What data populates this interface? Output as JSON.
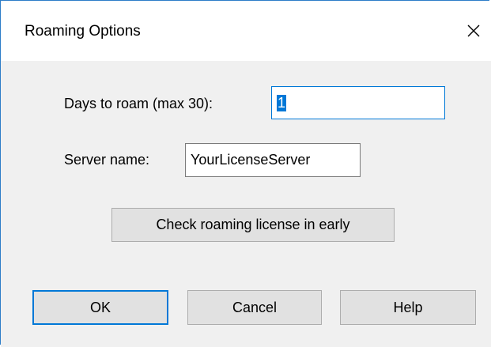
{
  "window": {
    "title": "Roaming Options"
  },
  "icons": {
    "close": "close-icon"
  },
  "fields": {
    "days_label": "Days to roam (max 30):",
    "days_value": "1",
    "server_label": "Server name:",
    "server_value": "YourLicenseServer"
  },
  "buttons": {
    "check_in_label": "Check roaming license in early",
    "ok_label": "OK",
    "cancel_label": "Cancel",
    "help_label": "Help"
  },
  "colors": {
    "accent": "#0078d7",
    "window_border": "#2d7dc8",
    "dialog_bg": "#f0f0f0"
  }
}
